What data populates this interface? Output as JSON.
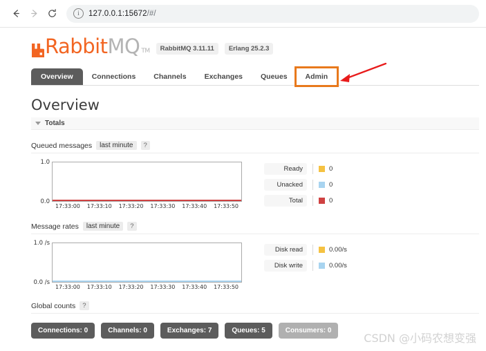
{
  "browser": {
    "back_icon": "arrow-left-icon",
    "forward_icon": "arrow-right-icon",
    "reload_icon": "reload-icon",
    "site_info_icon": "info-circle-icon",
    "url_host": "127.0.0.1:15672",
    "url_path": "/#/",
    "url_full": "127.0.0.1:15672/#/"
  },
  "branding": {
    "logo_rabbit": "Rabbit",
    "logo_mq": "MQ",
    "logo_tm": "TM",
    "version_rabbitmq": "RabbitMQ 3.11.11",
    "version_erlang": "Erlang 25.2.3",
    "logo_color": "#f26522",
    "logo_mq_color": "#b4b4b4"
  },
  "tabs": [
    {
      "label": "Overview",
      "active": true
    },
    {
      "label": "Connections",
      "active": false
    },
    {
      "label": "Channels",
      "active": false
    },
    {
      "label": "Exchanges",
      "active": false
    },
    {
      "label": "Queues",
      "active": false
    },
    {
      "label": "Admin",
      "active": false,
      "highlighted": true
    }
  ],
  "page": {
    "title": "Overview",
    "totals_label": "Totals"
  },
  "sections": {
    "queued_messages": {
      "title": "Queued messages",
      "period": "last minute",
      "help": "?"
    },
    "message_rates": {
      "title": "Message rates",
      "period": "last minute",
      "help": "?"
    },
    "global_counts": {
      "title": "Global counts",
      "help": "?"
    }
  },
  "global_counts": [
    {
      "label": "Connections: 0",
      "muted": false
    },
    {
      "label": "Channels: 0",
      "muted": false
    },
    {
      "label": "Exchanges: 7",
      "muted": false
    },
    {
      "label": "Queues: 5",
      "muted": false
    },
    {
      "label": "Consumers: 0",
      "muted": true
    }
  ],
  "annotation": {
    "highlight_color": "#e8791c",
    "arrow_color": "#e81b1b",
    "target": "Admin"
  },
  "watermark": "CSDN @小码农想变强",
  "chart_data": [
    {
      "type": "line",
      "title": "Queued messages",
      "subtitle": "last minute",
      "xlabel": "",
      "ylabel": "",
      "ylim": [
        0,
        1
      ],
      "y_ticks": [
        "0.0",
        "1.0"
      ],
      "x": [
        "17:33:00",
        "17:33:10",
        "17:33:20",
        "17:33:30",
        "17:33:40",
        "17:33:50"
      ],
      "grid": false,
      "legend_position": "right",
      "series": [
        {
          "name": "Ready",
          "color": "#f5c242",
          "value": "0",
          "values": [
            0,
            0,
            0,
            0,
            0,
            0
          ]
        },
        {
          "name": "Unacked",
          "color": "#a8d4f0",
          "value": "0",
          "values": [
            0,
            0,
            0,
            0,
            0,
            0
          ]
        },
        {
          "name": "Total",
          "color": "#cf4242",
          "value": "0",
          "values": [
            0,
            0,
            0,
            0,
            0,
            0
          ]
        }
      ]
    },
    {
      "type": "line",
      "title": "Message rates",
      "subtitle": "last minute",
      "xlabel": "",
      "ylabel": "/s",
      "ylim": [
        0,
        1
      ],
      "y_ticks": [
        "0.0 /s",
        "1.0 /s"
      ],
      "x": [
        "17:33:00",
        "17:33:10",
        "17:33:20",
        "17:33:30",
        "17:33:40",
        "17:33:50"
      ],
      "grid": false,
      "legend_position": "right",
      "series": [
        {
          "name": "Disk read",
          "color": "#f5c242",
          "value": "0.00/s",
          "values": [
            0,
            0,
            0,
            0,
            0,
            0
          ]
        },
        {
          "name": "Disk write",
          "color": "#a8d4f0",
          "value": "0.00/s",
          "values": [
            0,
            0,
            0,
            0,
            0,
            0
          ]
        }
      ]
    }
  ]
}
